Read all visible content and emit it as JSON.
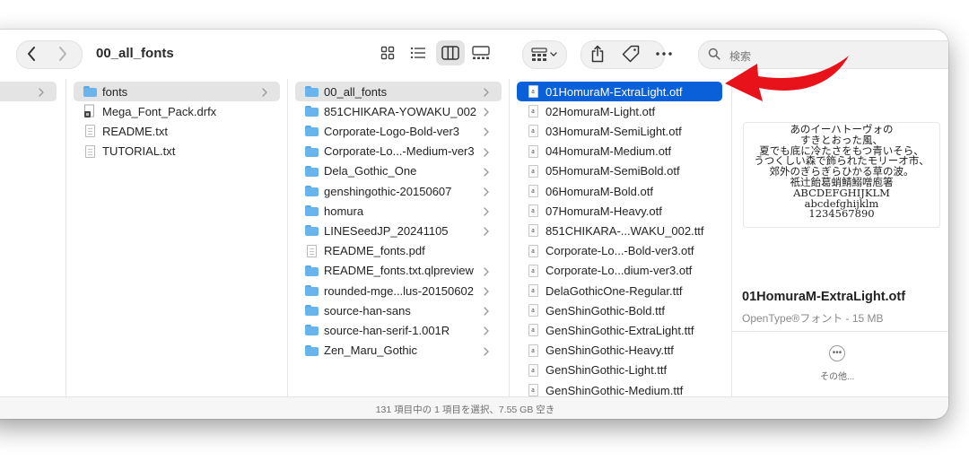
{
  "toolbar": {
    "path_title": "00_all_fonts",
    "search_placeholder": "検索"
  },
  "columns": {
    "col1": {
      "items": [
        {
          "label": "",
          "selected": true
        }
      ]
    },
    "col2": {
      "items": [
        {
          "label": "fonts",
          "type": "folder",
          "selected": true
        },
        {
          "label": "Mega_Font_Pack.drfx",
          "type": "package"
        },
        {
          "label": "README.txt",
          "type": "text"
        },
        {
          "label": "TUTORIAL.txt",
          "type": "text"
        }
      ]
    },
    "col3": {
      "items": [
        {
          "label": "00_all_fonts",
          "type": "folder",
          "selected": true
        },
        {
          "label": "851CHIKARA-YOWAKU_002",
          "type": "folder"
        },
        {
          "label": "Corporate-Logo-Bold-ver3",
          "type": "folder"
        },
        {
          "label": "Corporate-Lo...-Medium-ver3",
          "type": "folder"
        },
        {
          "label": "Dela_Gothic_One",
          "type": "folder"
        },
        {
          "label": "genshingothic-20150607",
          "type": "folder"
        },
        {
          "label": "homura",
          "type": "folder"
        },
        {
          "label": "LINESeedJP_20241105",
          "type": "folder"
        },
        {
          "label": "README_fonts.pdf",
          "type": "pdf"
        },
        {
          "label": "README_fonts.txt.qlpreview",
          "type": "folder"
        },
        {
          "label": "rounded-mge...lus-20150602",
          "type": "folder"
        },
        {
          "label": "source-han-sans",
          "type": "folder"
        },
        {
          "label": "source-han-serif-1.001R",
          "type": "folder"
        },
        {
          "label": "Zen_Maru_Gothic",
          "type": "folder"
        }
      ]
    },
    "col4": {
      "items": [
        {
          "label": "01HomuraM-ExtraLight.otf",
          "selected": true
        },
        {
          "label": "02HomuraM-Light.otf"
        },
        {
          "label": "03HomuraM-SemiLight.otf"
        },
        {
          "label": "04HomuraM-Medium.otf"
        },
        {
          "label": "05HomuraM-SemiBold.otf"
        },
        {
          "label": "06HomuraM-Bold.otf"
        },
        {
          "label": "07HomuraM-Heavy.otf"
        },
        {
          "label": "851CHIKARA-...WAKU_002.ttf"
        },
        {
          "label": "Corporate-Lo...-Bold-ver3.otf"
        },
        {
          "label": "Corporate-Lo...dium-ver3.otf"
        },
        {
          "label": "DelaGothicOne-Regular.ttf"
        },
        {
          "label": "GenShinGothic-Bold.ttf"
        },
        {
          "label": "GenShinGothic-ExtraLight.ttf"
        },
        {
          "label": "GenShinGothic-Heavy.ttf"
        },
        {
          "label": "GenShinGothic-Light.ttf"
        },
        {
          "label": "GenShinGothic-Medium.ttf"
        }
      ]
    }
  },
  "preview": {
    "sample_lines": [
      "あのイーハトーヴォの",
      "すきとおった風、",
      "夏でも底に冷たさをもつ青いそら、",
      "うつくしい森で飾られたモリーオ市、",
      "郊外のぎらぎらひかる草の波。",
      "祇辻飴葛蛸鯖鰯噌庖箸",
      "ABCDEFGHIJKLM",
      "abcdefghijklm",
      "1234567890"
    ],
    "file_name": "01HomuraM-ExtraLight.otf",
    "file_kind": "OpenType®フォント - 15 MB",
    "more_label": "その他..."
  },
  "status": {
    "text": "131 項目中の 1 項目を選択、7.55 GB 空き"
  },
  "colors": {
    "selection": "#0a60d8",
    "folder": "#6ab4ee",
    "arrow": "#e8121a"
  },
  "icons": [
    "chevron-left-icon",
    "chevron-right-icon",
    "grid-view-icon",
    "list-view-icon",
    "column-view-icon",
    "gallery-view-icon",
    "group-icon",
    "share-icon",
    "tag-icon",
    "more-icon",
    "search-icon",
    "folder-icon",
    "document-icon",
    "font-file-icon",
    "red-arrow"
  ]
}
